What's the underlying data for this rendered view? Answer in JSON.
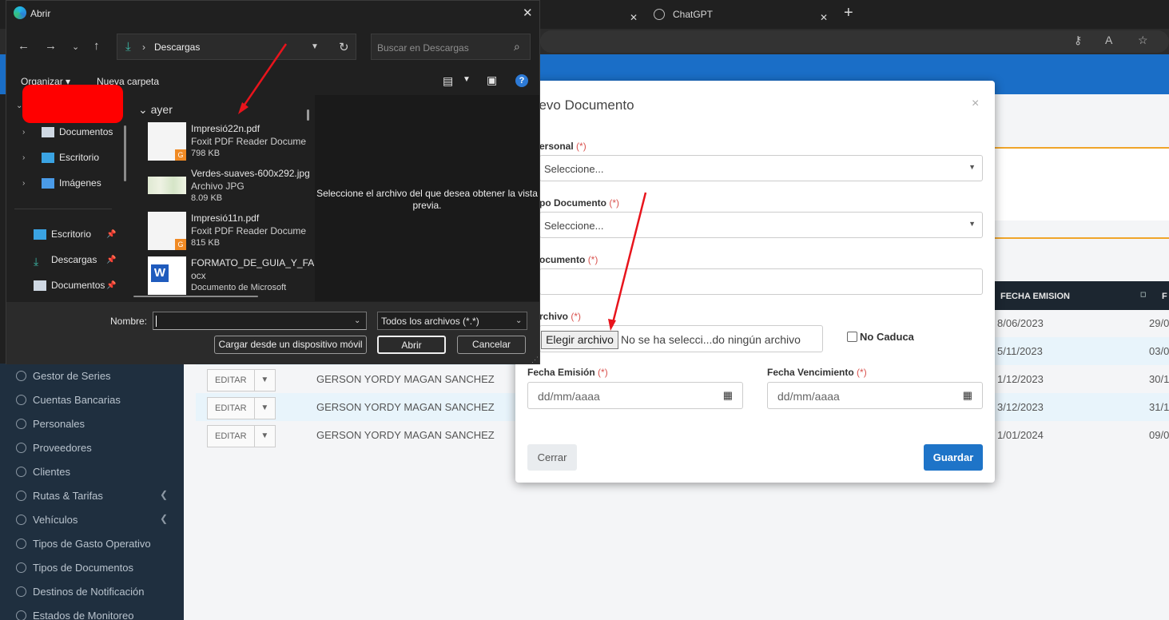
{
  "browser": {
    "tabs": [
      {
        "label": ""
      },
      {
        "label": "ChatGPT"
      }
    ],
    "new_tab": "+"
  },
  "background_page": {
    "table": {
      "header_fecha_emision": "FECHA EMISION",
      "header_partial": "F",
      "rows": [
        {
          "date": "8/06/2023",
          "date2": "29/0"
        },
        {
          "date": "5/11/2023",
          "date2": "03/0"
        },
        {
          "edit": "EDITAR",
          "name": "GERSON YORDY MAGAN SANCHEZ",
          "date": "1/12/2023",
          "date2": "30/1"
        },
        {
          "edit": "EDITAR",
          "name": "GERSON YORDY MAGAN SANCHEZ",
          "date": "3/12/2023",
          "date2": "31/1"
        },
        {
          "edit": "EDITAR",
          "name": "GERSON YORDY MAGAN SANCHEZ",
          "date": "1/01/2024",
          "date2": "09/0"
        }
      ]
    },
    "sidebar": [
      {
        "label": "Gestor de Series"
      },
      {
        "label": "Cuentas Bancarias"
      },
      {
        "label": "Personales"
      },
      {
        "label": "Proveedores"
      },
      {
        "label": "Clientes"
      },
      {
        "label": "Rutas & Tarifas"
      },
      {
        "label": "Vehículos"
      },
      {
        "label": "Tipos de Gasto Operativo"
      },
      {
        "label": "Tipos de Documentos"
      },
      {
        "label": "Destinos de Notificación"
      },
      {
        "label": "Estados de Monitoreo"
      }
    ]
  },
  "modal": {
    "title": "uevo Documento",
    "close": "×",
    "required_mark": "(*)",
    "personal_label": "ersonal",
    "personal_value": "Seleccione...",
    "tipo_label": "po Documento",
    "tipo_value": "Seleccione...",
    "documento_label": "ocumento",
    "archivo_label": "rchivo",
    "file_button": "Elegir archivo",
    "file_status": "No se ha selecci...do ningún archivo",
    "no_caduca": "No Caduca",
    "fecha_emision_label": "Fecha Emisión",
    "fecha_vencimiento_label": "Fecha Vencimiento",
    "date_placeholder": "dd/mm/aaaa",
    "cerrar": "Cerrar",
    "guardar": "Guardar"
  },
  "dialog": {
    "title": "Abrir",
    "path": "Descargas",
    "search_placeholder": "Buscar en Descargas",
    "organizar": "Organizar",
    "nueva_carpeta": "Nueva carpeta",
    "tree": [
      {
        "label": "Documentos"
      },
      {
        "label": "Escritorio"
      },
      {
        "label": "Imágenes"
      }
    ],
    "quick_access": [
      {
        "label": "Escritorio"
      },
      {
        "label": "Descargas"
      },
      {
        "label": "Documentos"
      }
    ],
    "group": "ayer",
    "files": [
      {
        "name": "Impresió22n.pdf",
        "type": "Foxit PDF Reader Docume",
        "size": "798 KB"
      },
      {
        "name": "Verdes-suaves-600x292.jpg",
        "type": "Archivo JPG",
        "size": "8.09 KB"
      },
      {
        "name": "Impresió11n.pdf",
        "type": "Foxit PDF Reader Docume",
        "size": "815 KB"
      },
      {
        "name": "FORMATO_DE_GUIA_Y_FA",
        "type": "ocx",
        "size": "Documento de Microsoft"
      }
    ],
    "preview_text": "Seleccione el archivo del que desea obtener la vista previa.",
    "nombre_label": "Nombre:",
    "filter": "Todos los archivos (*.*)",
    "mobile_button": "Cargar desde un dispositivo móvil",
    "open_button": "Abrir",
    "cancel_button": "Cancelar"
  },
  "colors": {
    "accent_blue": "#1a6ec7",
    "annotation_red": "#ff0000",
    "required": "#d9534f"
  }
}
